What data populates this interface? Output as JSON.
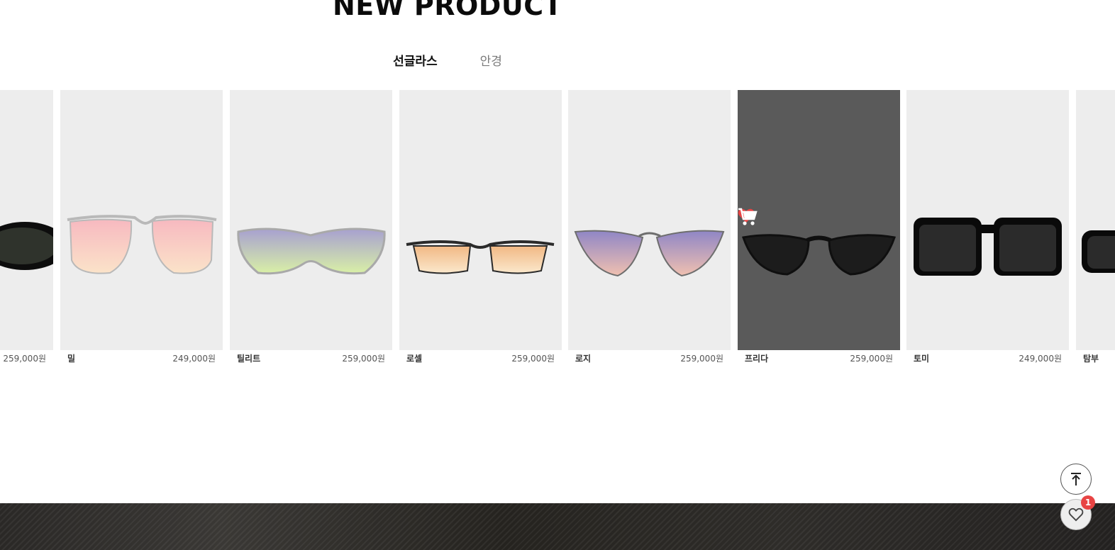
{
  "section": {
    "title": "NEW PRODUCT"
  },
  "tabs": [
    {
      "label": "선글라스",
      "active": true
    },
    {
      "label": "안경",
      "active": false
    }
  ],
  "products": [
    {
      "name": "",
      "price": "259,000원",
      "lens": "#2f332c",
      "frame": "#0d0d0d",
      "style": "round-dark"
    },
    {
      "name": "밀",
      "price": "249,000원",
      "lens": "#f5c2c2",
      "frame": "#b9b9b9",
      "style": "wire-pink"
    },
    {
      "name": "틸리트",
      "price": "259,000원",
      "lens": "#b6b0cf",
      "frame": "#a9a9a9",
      "style": "shield"
    },
    {
      "name": "로셀",
      "price": "259,000원",
      "lens": "#f3c99e",
      "frame": "#2a2a2a",
      "style": "slim-orange"
    },
    {
      "name": "로지",
      "price": "259,000원",
      "lens": "#a8a2cf",
      "frame": "#6e6e6e",
      "style": "cat-purple"
    },
    {
      "name": "프리다",
      "price": "259,000원",
      "lens": "#1c1c1c",
      "frame": "#0f0f0f",
      "style": "cat-dark",
      "hovered": true
    },
    {
      "name": "토미",
      "price": "249,000원",
      "lens": "#2b2b2b",
      "frame": "#0a0a0a",
      "style": "square-black"
    },
    {
      "name": "탐부",
      "price": "",
      "lens": "#2b2b2b",
      "frame": "#0a0a0a",
      "style": "partial"
    }
  ],
  "colors": {
    "heart": "#e84444",
    "badge": "#e84444"
  },
  "floating": {
    "top_icon": "arrow-up-to-line-icon",
    "wish_icon": "heart-outline-icon",
    "wish_count": "1"
  }
}
